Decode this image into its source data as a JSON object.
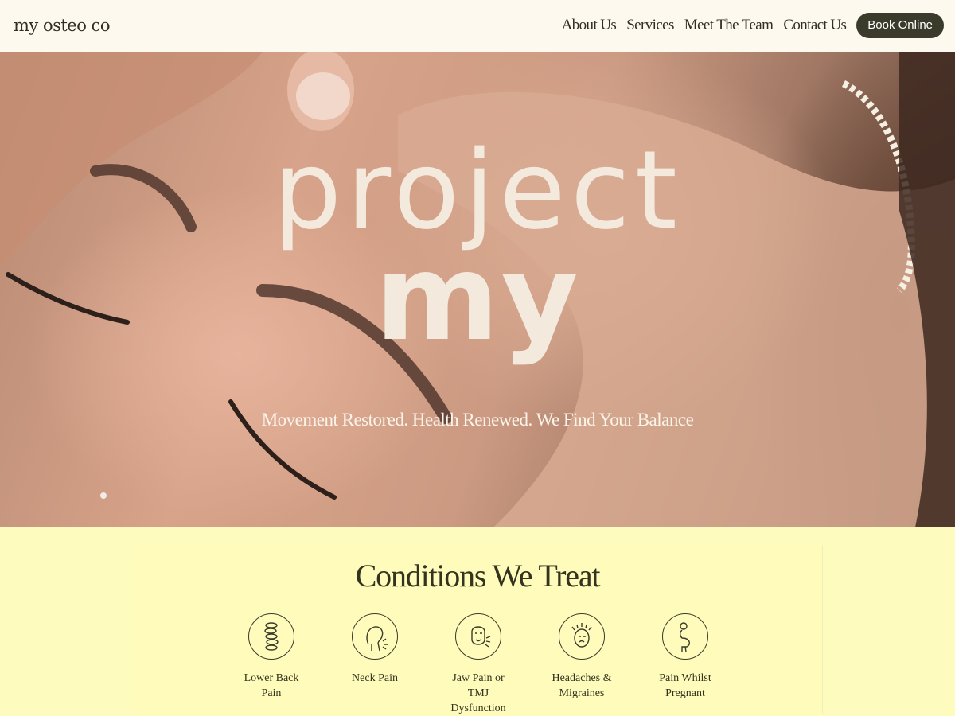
{
  "header": {
    "logo": "my osteo co",
    "nav": [
      "About Us",
      "Services",
      "Meet The Team",
      "Contact Us"
    ],
    "book_label": "Book Online"
  },
  "hero": {
    "title_line1": "project",
    "title_line2": "my",
    "tagline": "Movement Restored. Health Renewed. We Find Your Balance"
  },
  "conditions": {
    "title": "Conditions We Treat",
    "items": [
      {
        "label": "Lower Back Pain",
        "icon": "spine-icon"
      },
      {
        "label": "Neck Pain",
        "icon": "neck-icon"
      },
      {
        "label": "Jaw Pain or TMJ Dysfunction",
        "icon": "jaw-icon"
      },
      {
        "label": "Headaches & Migraines",
        "icon": "headache-icon"
      },
      {
        "label": "Pain Whilst Pregnant",
        "icon": "pregnancy-icon"
      }
    ]
  },
  "colors": {
    "header_bg": "#fdf9ee",
    "button_bg": "#3b3b2b",
    "conditions_bg": "#fdfbbd",
    "hero_text": "#f3e9dc"
  }
}
